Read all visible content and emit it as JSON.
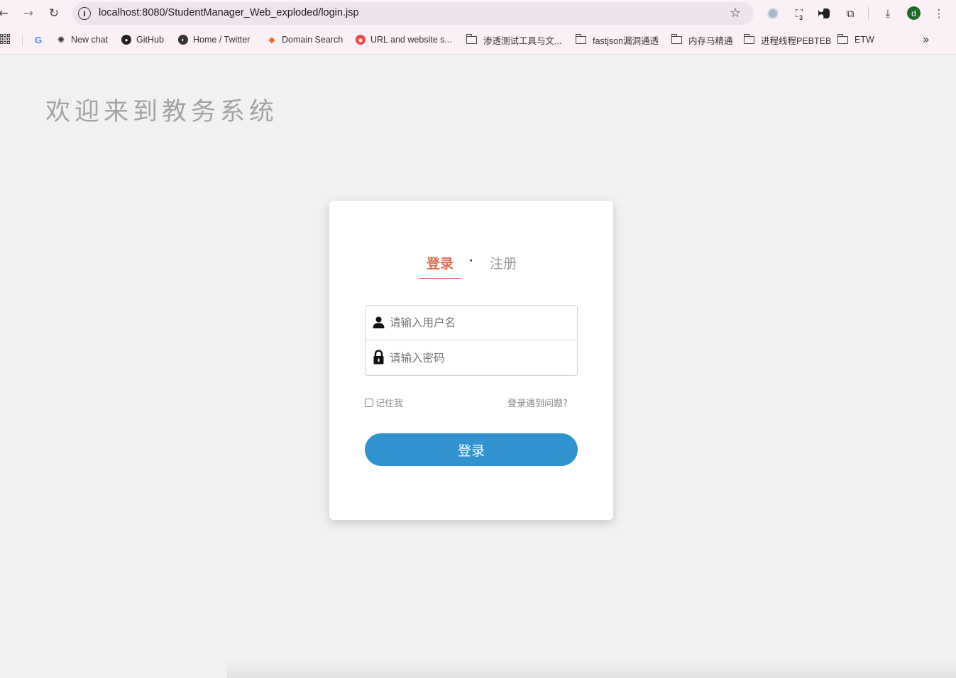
{
  "browser": {
    "url": "localhost:8080/StudentManager_Web_exploded/login.jsp",
    "extension_badge": "3",
    "profile_initial": "d",
    "bookmarks": [
      {
        "label": "New chat",
        "icon": "openai-icon"
      },
      {
        "label": "GitHub",
        "icon": "github-icon"
      },
      {
        "label": "Home / Twitter",
        "icon": "globe-icon"
      },
      {
        "label": "Domain Search",
        "icon": "hunter-icon"
      },
      {
        "label": "URL and website s...",
        "icon": "virustotal-icon"
      },
      {
        "label": "渗透测试工具与文...",
        "icon": "folder-icon"
      },
      {
        "label": "fastjson漏洞通透",
        "icon": "folder-icon"
      },
      {
        "label": "内存马精通",
        "icon": "folder-icon"
      },
      {
        "label": "进程线程PEBTEB",
        "icon": "folder-icon"
      },
      {
        "label": "ETW",
        "icon": "folder-icon"
      }
    ]
  },
  "page": {
    "welcome": "欢迎来到教务系统",
    "tabs": {
      "login": "登录",
      "separator": "·",
      "register": "注册"
    },
    "form": {
      "username_placeholder": "请输入用户名",
      "password_placeholder": "请输入密码",
      "remember_label": "记住我",
      "trouble_link": "登录遇到问题?",
      "submit_label": "登录"
    }
  },
  "colors": {
    "accent_tab": "#e06c52",
    "button": "#3093d0",
    "background": "#f1f1f1"
  }
}
